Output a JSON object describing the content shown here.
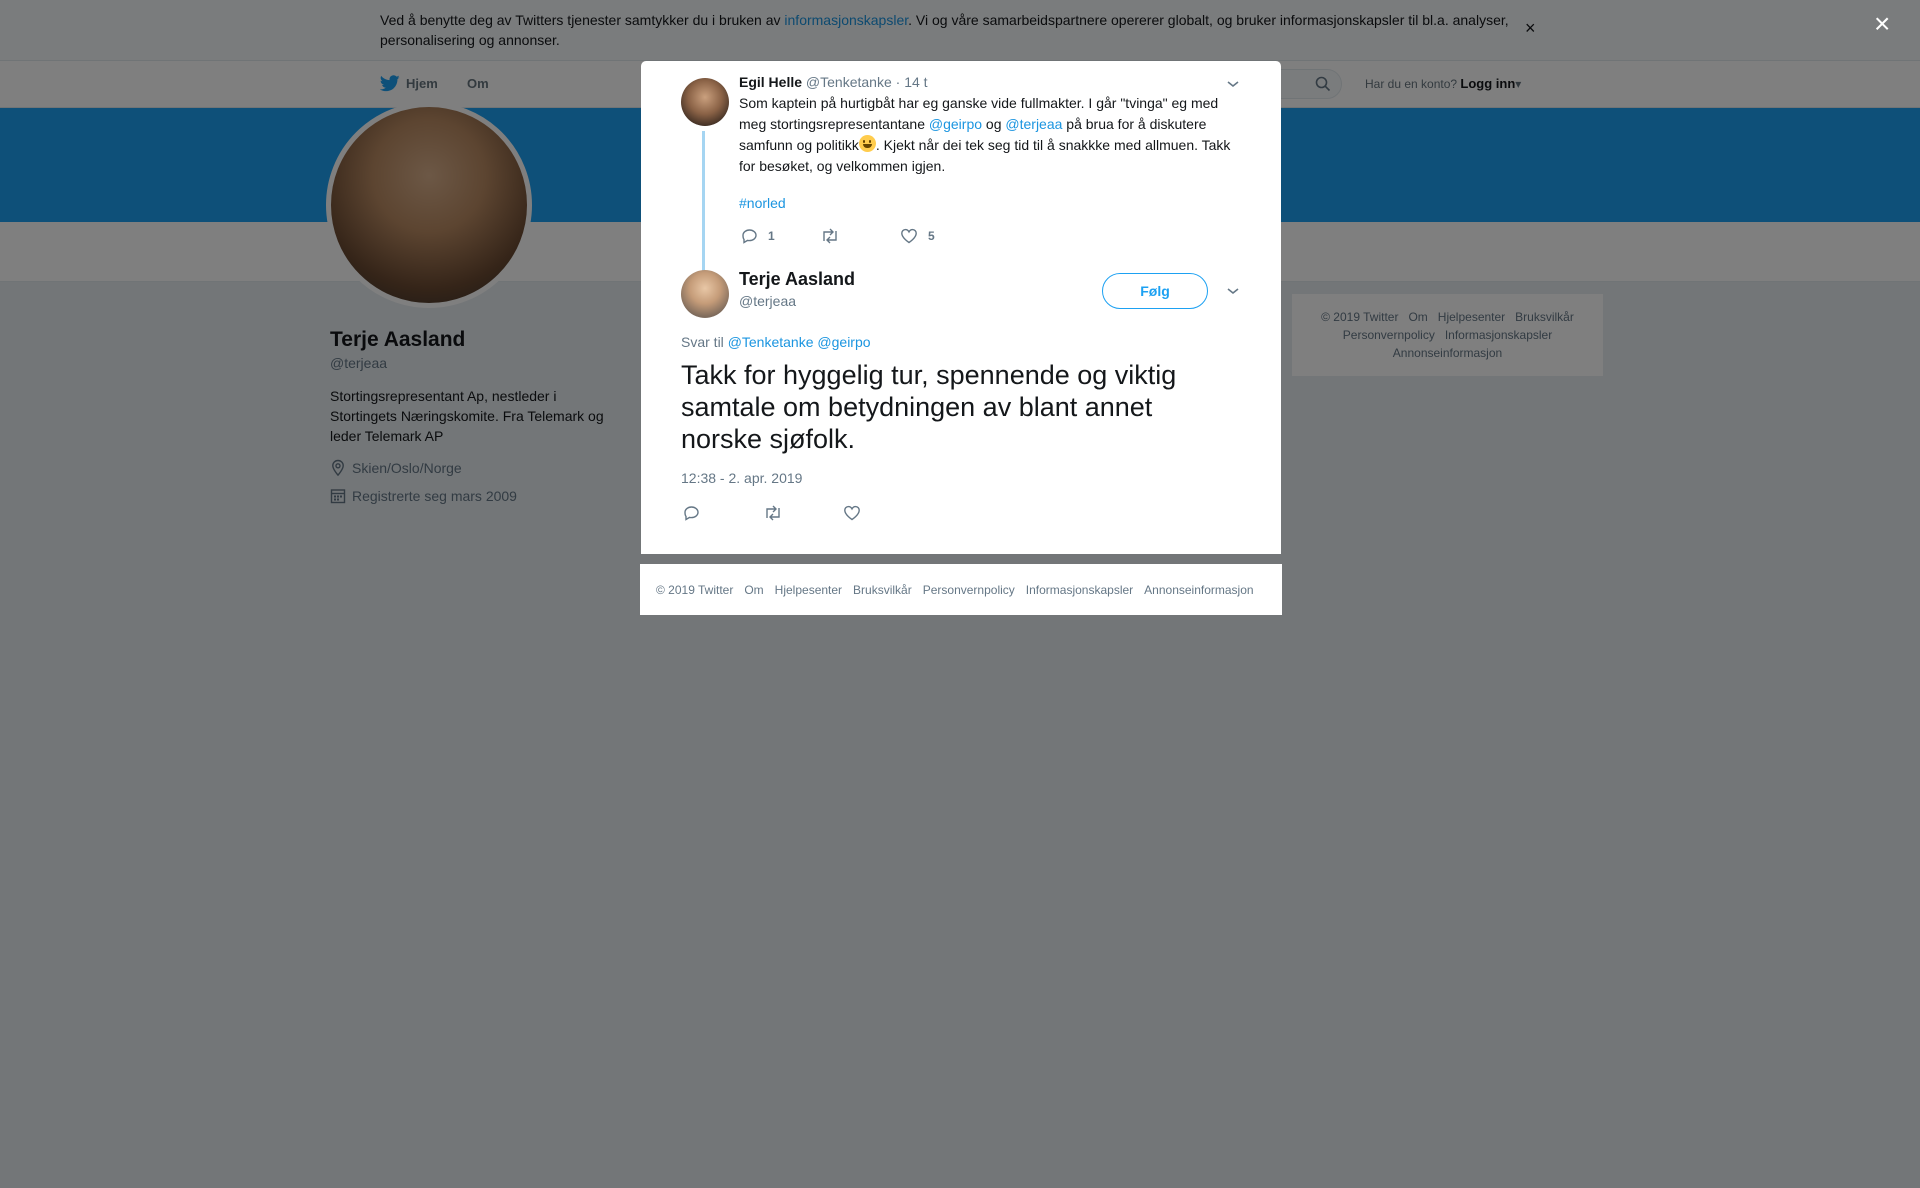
{
  "cookie_bar": {
    "text_before": "Ved å benytte deg av Twitters tjenester samtykker du i bruken av ",
    "link": "informasjonskapsler",
    "text_after": ". Vi og våre samarbeidspartnere opererer globalt, og bruker informasjonskapsler til bl.a. analyser, personalisering og annonser.",
    "close": "×"
  },
  "nav": {
    "home": "Hjem",
    "about": "Om",
    "login_prompt": "Har du en konto?",
    "login": "Logg inn"
  },
  "profile": {
    "name": "Terje Aasland",
    "handle": "@terjeaa",
    "bio": "Stortingsrepresentant Ap, nestleder i Stortingets Næringskomite. Fra Telemark og leder Telemark AP",
    "location": "Skien/Oslo/Norge",
    "joined": "Registrerte seg mars 2009"
  },
  "side_footer": {
    "links": [
      "© 2019 Twitter",
      "Om",
      "Hjelpesenter",
      "Bruksvilkår",
      "Personvernpolicy",
      "Informasjonskapsler",
      "Annonseinformasjon"
    ]
  },
  "page_close": "×",
  "parent_tweet": {
    "name": "Egil Helle",
    "handle": "@Tenketanke",
    "time": "· 14 t",
    "text_1": "Som kaptein på hurtigbåt har eg ganske vide fullmakter. I går \"tvinga\" eg med meg stortingsrepresentantane ",
    "mention_1": "@geirpo",
    "text_2": " og ",
    "mention_2": "@terjeaa",
    "text_3": " på brua for å diskutere samfunn og politikk",
    "text_4": ". Kjekt når dei tek seg tid til å snakkke med allmuen. Takk for besøket, og velkommen igjen.",
    "hashtag": "#norled",
    "replies": "1",
    "likes": "5"
  },
  "main_tweet": {
    "name": "Terje Aasland",
    "handle": "@terjeaa",
    "follow": "Følg",
    "reply_prefix": "Svar til",
    "reply_mention_1": "@Tenketanke",
    "reply_mention_2": "@geirpo",
    "text": "Takk for hyggelig tur, spennende og viktig samtale om betydningen av blant annet norske sjøfolk.",
    "timestamp": "12:38 - 2. apr. 2019"
  },
  "modal_footer": {
    "links": [
      "© 2019 Twitter",
      "Om",
      "Hjelpesenter",
      "Bruksvilkår",
      "Personvernpolicy",
      "Informasjonskapsler",
      "Annonseinformasjon"
    ]
  },
  "colors": {
    "brand": "#1da1f2",
    "link": "#1b95e0",
    "thread_line": "#a5d5f2",
    "muted": "#657786"
  }
}
